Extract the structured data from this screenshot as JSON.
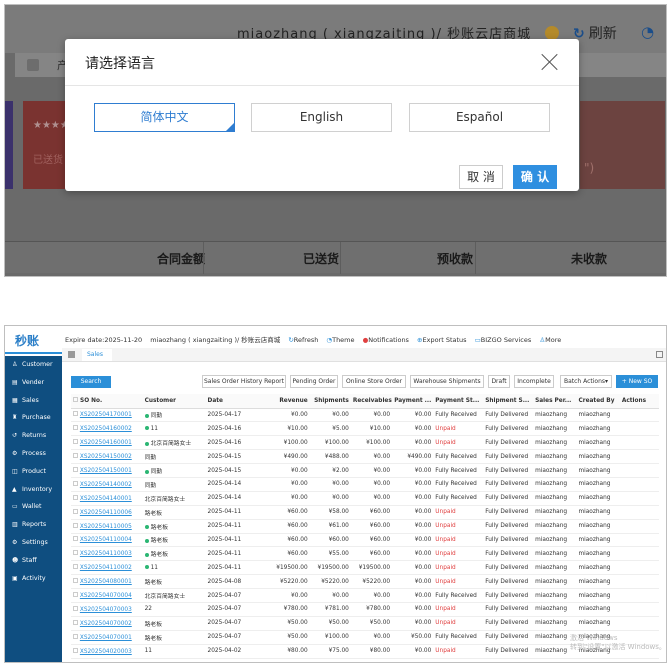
{
  "top": {
    "header_title": "miaozhang ( xiangzaiting )/ 秒账云店商城",
    "refresh": "刷新",
    "tab_label": "产",
    "stars": "★★★★",
    "shipped_partial": "已送货",
    "card_right": "\")",
    "table_headers": [
      "合同金额",
      "已送货",
      "预收款",
      "未收款"
    ],
    "modal": {
      "title": "请选择语言",
      "languages": [
        "简体中文",
        "English",
        "Español"
      ],
      "selected_index": 0,
      "cancel": "取 消",
      "confirm": "确 认"
    }
  },
  "app": {
    "logo": "秒账",
    "expire": "Expire date:2025-11-20",
    "account": "miaozhang ( xiangzaiting )/ 秒账云店商城",
    "top_items": [
      "Refresh",
      "Theme",
      "Notifications",
      "Export Status",
      "BIZGO Services",
      "More"
    ],
    "tab": "Sales",
    "sidebar": [
      "Customer",
      "Vender",
      "Sales",
      "Purchase",
      "Returns",
      "Process",
      "Product",
      "Inventory",
      "Wallet",
      "Reports",
      "Settings",
      "Staff",
      "Activity"
    ],
    "search": "Search",
    "toolbar": [
      "Sales Order History Report",
      "Pending Order",
      "Online Store Order",
      "Warehouse Shipments",
      "Draft",
      "Incomplete",
      "Batch Actions▾"
    ],
    "new_so": "+ New SO",
    "columns": [
      "SO No.",
      "Customer",
      "Date",
      "Revenue",
      "Shipments",
      "Receivables",
      "Payment ...",
      "Payment St...",
      "Shipment S...",
      "Sales Per...",
      "Created By",
      "Actions"
    ],
    "rows": [
      [
        "XS202504170001",
        "同勤",
        "2025-04-17",
        "¥0.00",
        "¥0.00",
        "¥0.00",
        "¥0.00",
        "Fully Received",
        "Fully Delivered",
        "miaozhang",
        "miaozhang"
      ],
      [
        "XS202504160002",
        "11",
        "2025-04-16",
        "¥10.00",
        "¥5.00",
        "¥10.00",
        "¥0.00",
        "Unpaid",
        "Fully Delivered",
        "miaozhang",
        "miaozhang"
      ],
      [
        "XS202504160001",
        "北京百简路女士",
        "2025-04-16",
        "¥100.00",
        "¥100.00",
        "¥100.00",
        "¥0.00",
        "Unpaid",
        "Fully Delivered",
        "miaozhang",
        "miaozhang"
      ],
      [
        "XS202504150002",
        "同勤",
        "2025-04-15",
        "¥490.00",
        "¥488.00",
        "¥0.00",
        "¥490.00",
        "Fully Received",
        "Fully Delivered",
        "miaozhang",
        "miaozhang"
      ],
      [
        "XS202504150001",
        "同勤",
        "2025-04-15",
        "¥0.00",
        "¥2.00",
        "¥0.00",
        "¥0.00",
        "Fully Received",
        "Fully Delivered",
        "miaozhang",
        "miaozhang"
      ],
      [
        "XS202504140002",
        "同勤",
        "2025-04-14",
        "¥0.00",
        "¥0.00",
        "¥0.00",
        "¥0.00",
        "Fully Received",
        "Fully Delivered",
        "miaozhang",
        "miaozhang"
      ],
      [
        "XS202504140001",
        "北京百简路女士",
        "2025-04-14",
        "¥0.00",
        "¥0.00",
        "¥0.00",
        "¥0.00",
        "Fully Received",
        "Fully Delivered",
        "miaozhang",
        "miaozhang"
      ],
      [
        "XS202504110006",
        "路老板",
        "2025-04-11",
        "¥60.00",
        "¥58.00",
        "¥60.00",
        "¥0.00",
        "Unpaid",
        "Fully Delivered",
        "miaozhang",
        "miaozhang"
      ],
      [
        "XS202504110005",
        "路老板",
        "2025-04-11",
        "¥60.00",
        "¥61.00",
        "¥60.00",
        "¥0.00",
        "Unpaid",
        "Fully Delivered",
        "miaozhang",
        "miaozhang"
      ],
      [
        "XS202504110004",
        "路老板",
        "2025-04-11",
        "¥60.00",
        "¥60.00",
        "¥60.00",
        "¥0.00",
        "Unpaid",
        "Fully Delivered",
        "miaozhang",
        "miaozhang"
      ],
      [
        "XS202504110003",
        "路老板",
        "2025-04-11",
        "¥60.00",
        "¥55.00",
        "¥60.00",
        "¥0.00",
        "Unpaid",
        "Fully Delivered",
        "miaozhang",
        "miaozhang"
      ],
      [
        "XS202504110002",
        "11",
        "2025-04-11",
        "¥19500.00",
        "¥19500.00",
        "¥19500.00",
        "¥0.00",
        "Unpaid",
        "Fully Delivered",
        "miaozhang",
        "miaozhang"
      ],
      [
        "XS202504080001",
        "路老板",
        "2025-04-08",
        "¥5220.00",
        "¥5220.00",
        "¥5220.00",
        "¥0.00",
        "Unpaid",
        "Fully Delivered",
        "miaozhang",
        "miaozhang"
      ],
      [
        "XS202504070004",
        "北京百简路女士",
        "2025-04-07",
        "¥0.00",
        "¥0.00",
        "¥0.00",
        "¥0.00",
        "Fully Received",
        "Fully Delivered",
        "miaozhang",
        "miaozhang"
      ],
      [
        "XS202504070003",
        "22",
        "2025-04-07",
        "¥780.00",
        "¥781.00",
        "¥780.00",
        "¥0.00",
        "Unpaid",
        "Fully Delivered",
        "miaozhang",
        "miaozhang"
      ],
      [
        "XS202504070002",
        "路老板",
        "2025-04-07",
        "¥50.00",
        "¥50.00",
        "¥50.00",
        "¥0.00",
        "Unpaid",
        "Fully Delivered",
        "miaozhang",
        "miaozhang"
      ],
      [
        "XS202504070001",
        "路老板",
        "2025-04-07",
        "¥50.00",
        "¥100.00",
        "¥0.00",
        "¥50.00",
        "Fully Received",
        "Fully Delivered",
        "miaozhang",
        "miaozhang"
      ],
      [
        "XS202504020003",
        "11",
        "2025-04-02",
        "¥80.00",
        "¥75.00",
        "¥80.00",
        "¥0.00",
        "Unpaid",
        "Fully Delivered",
        "miaozhang",
        "miaozhang"
      ]
    ],
    "dot_rows": [
      0,
      1,
      2,
      4,
      8,
      9,
      10,
      11
    ],
    "watermark": [
      "激活 Windows",
      "转到\"设置\"以激活 Windows。"
    ]
  }
}
